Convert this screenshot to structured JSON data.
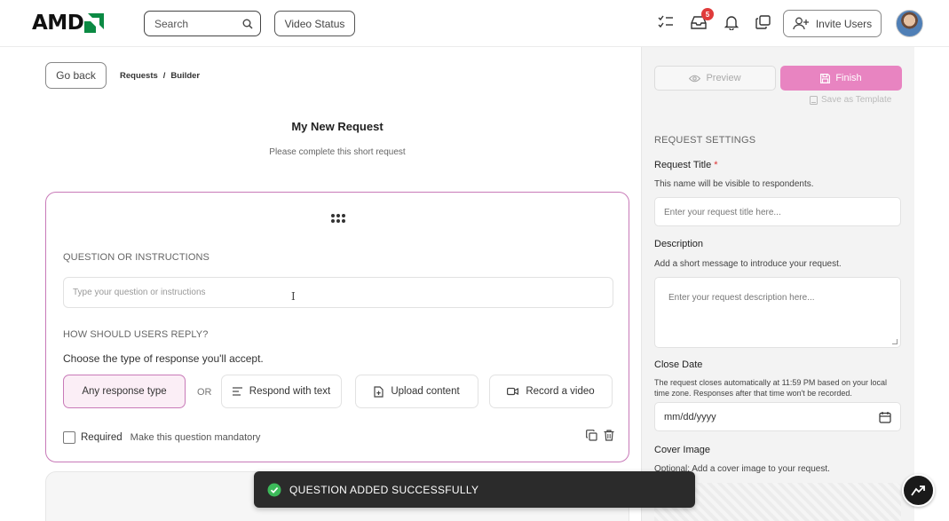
{
  "header": {
    "logo_text": "AMD",
    "search_placeholder": "Search",
    "video_status_label": "Video Status",
    "inbox_badge": "5",
    "invite_users_label": "Invite Users"
  },
  "main": {
    "go_back_label": "Go back",
    "breadcrumb": [
      "Requests",
      "/",
      "Builder"
    ],
    "title": "My New Request",
    "subtitle": "Please complete this short request",
    "question_card": {
      "section_label": "QUESTION OR INSTRUCTIONS",
      "question_placeholder": "Type your question or instructions",
      "reply_label": "HOW SHOULD USERS REPLY?",
      "choose_text": "Choose the type of response you'll accept.",
      "response_types": [
        {
          "label": "Any response type",
          "icon": "none",
          "selected": true
        },
        {
          "label": "Respond with text",
          "icon": "text-lines-icon",
          "selected": false
        },
        {
          "label": "Upload content",
          "icon": "file-upload-icon",
          "selected": false
        },
        {
          "label": "Record a video",
          "icon": "video-camera-icon",
          "selected": false
        }
      ],
      "or_text": "OR",
      "required_label": "Required",
      "required_hint": "Make this question mandatory",
      "required_checked": false
    }
  },
  "panel": {
    "preview_label": "Preview",
    "finish_label": "Finish",
    "save_template_label": "Save as Template",
    "heading": "REQUEST SETTINGS",
    "request_title_label": "Request Title",
    "request_title_required": "*",
    "request_title_hint": "This name will be visible to respondents.",
    "request_title_placeholder": "Enter your request title here...",
    "description_label": "Description",
    "description_hint": "Add a short message to introduce your request.",
    "description_placeholder": "Enter your request description here...",
    "close_date_label": "Close Date",
    "close_date_hint": "The request closes automatically at 11:59 PM based on your local time zone. Responses after that time won't be recorded.",
    "close_date_value": "mm/dd/yyyy",
    "cover_image_label": "Cover Image",
    "cover_image_hint": "Optional: Add a cover image to your request."
  },
  "toast": {
    "message": "QUESTION ADDED SUCCESSFULLY",
    "status": "success"
  },
  "colors": {
    "accent_pink": "#e884c1",
    "card_border": "#c87ab8",
    "logo_green": "#0b8a43",
    "badge_red": "#e03b3b",
    "success_green": "#3cba5a"
  }
}
